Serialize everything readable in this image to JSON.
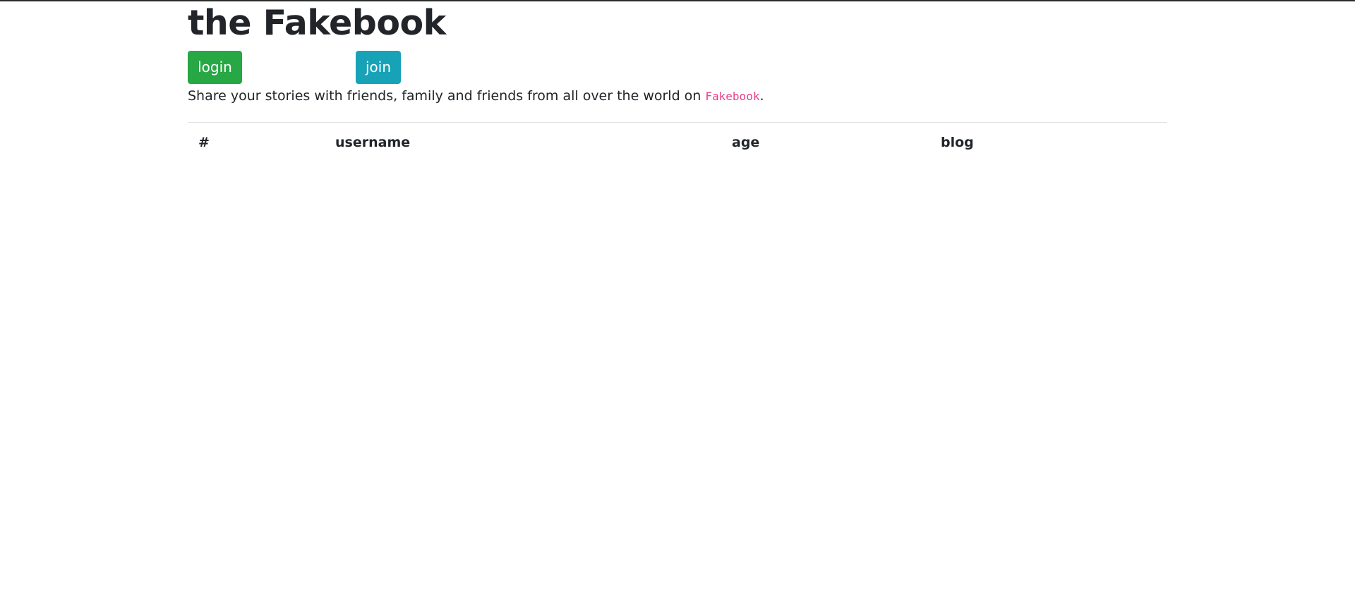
{
  "header": {
    "title": "the Fakebook"
  },
  "actions": {
    "login_label": "login",
    "join_label": "join"
  },
  "lead": {
    "text_before": "Share your stories with friends, family and friends from all over the world on ",
    "brand": "Fakebook",
    "text_after": "."
  },
  "table": {
    "columns": [
      "#",
      "username",
      "age",
      "blog"
    ],
    "rows": []
  },
  "colors": {
    "login": "#28a745",
    "join": "#17a2b8",
    "brand_code": "#e83e8c",
    "text": "#212529"
  }
}
